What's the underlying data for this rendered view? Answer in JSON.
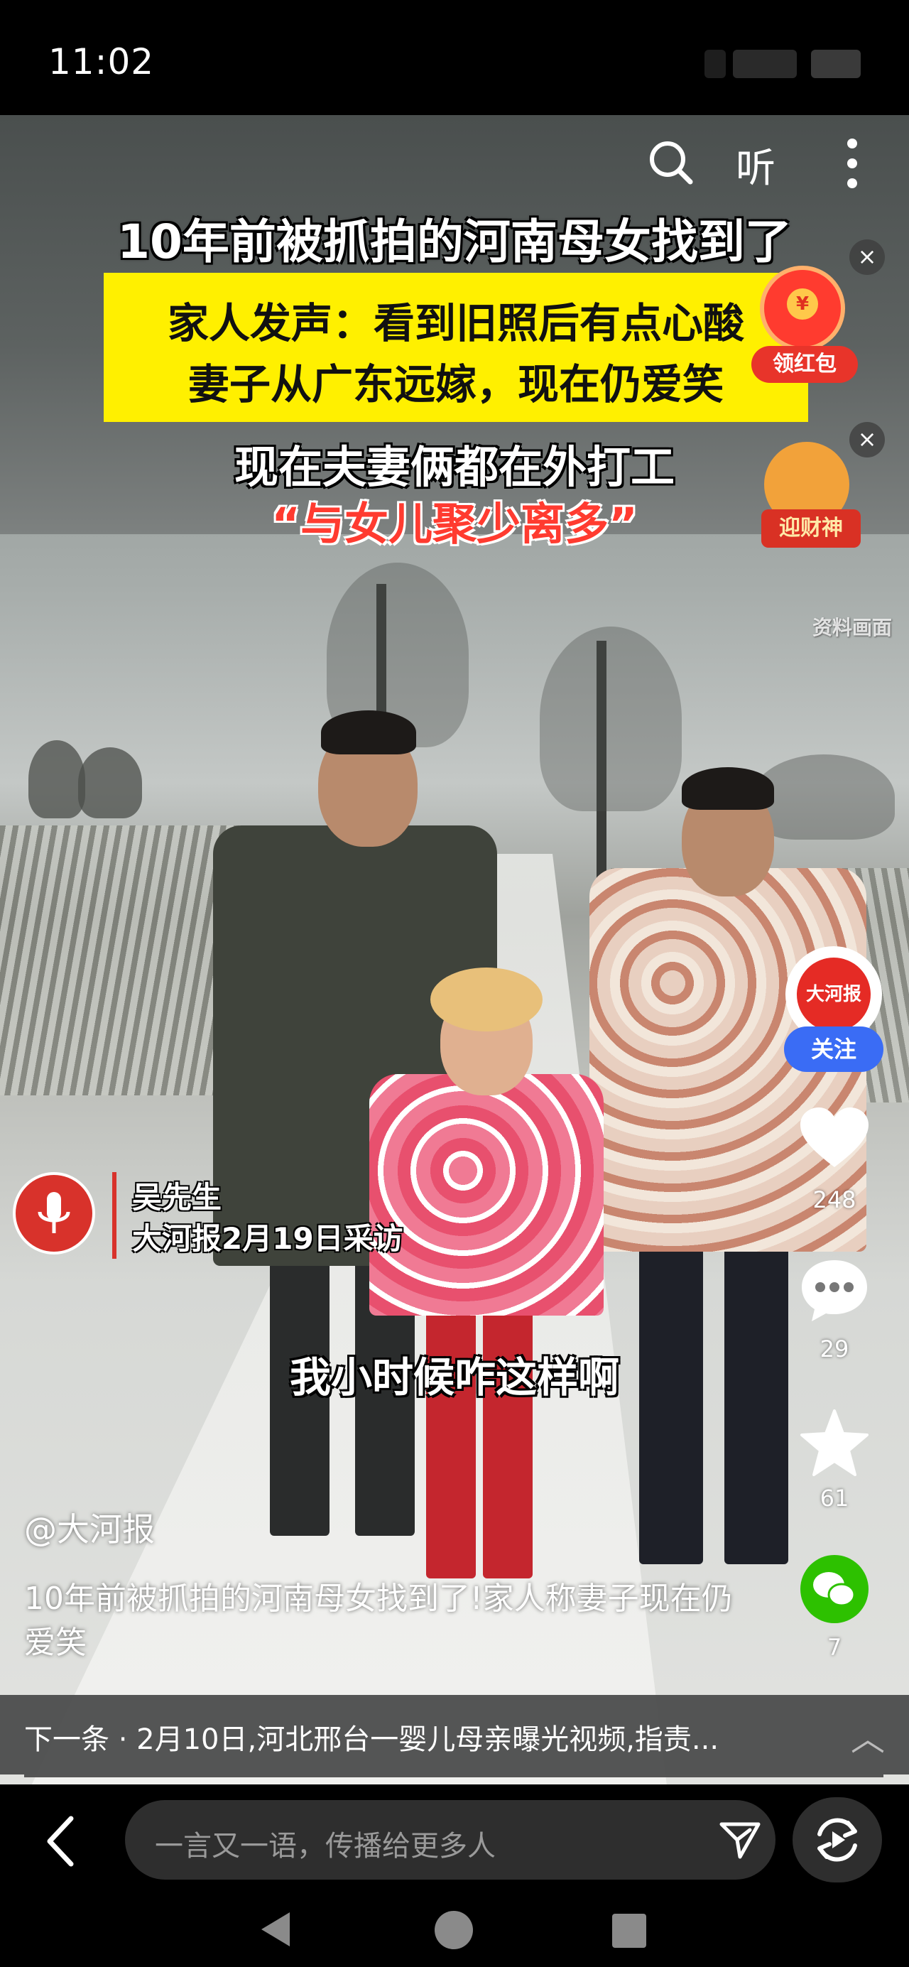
{
  "status_bar": {
    "time": "11:02"
  },
  "top_controls": {
    "listen_label": "听"
  },
  "video": {
    "headline": "10年前被抓拍的河南母女找到了",
    "yellow_box_lines": [
      "家人发声：看到旧照后有点心酸",
      "妻子从广东远嫁，现在仍爱笑"
    ],
    "subhead_1": "现在夫妻俩都在外打工",
    "subhead_2": "“与女儿聚少离多”",
    "watermark": "资料画面",
    "interviewee_name": "吴先生",
    "interview_source": "大河报2月19日采访",
    "subtitle": "我小时候咋这样啊"
  },
  "promos": {
    "red_packet_label": "领红包",
    "caishen_label": "迎财神"
  },
  "rail": {
    "avatar_text": "大河报",
    "follow_label": "关注",
    "likes": "248",
    "comments": "29",
    "favorites": "61",
    "shares": "7"
  },
  "caption": {
    "author": "@大河报",
    "description": "10年前被抓拍的河南母女找到了!家人称妻子现在仍爱笑"
  },
  "next": {
    "text": "下一条 · 2月10日,河北邢台一婴儿母亲曝光视频,指责..."
  },
  "bottom": {
    "comment_placeholder": "一言又一语，传播给更多人"
  },
  "colors": {
    "accent_blue": "#3a6cf5",
    "brand_red": "#e52b25",
    "headline_yellow": "#fff000",
    "wechat_green": "#2dc100"
  },
  "icons": [
    "search-icon",
    "more-icon",
    "close-icon",
    "heart-icon",
    "comment-icon",
    "star-icon",
    "wechat-icon",
    "back-icon",
    "send-icon",
    "share-icon",
    "chevron-up-icon",
    "mic-icon"
  ]
}
